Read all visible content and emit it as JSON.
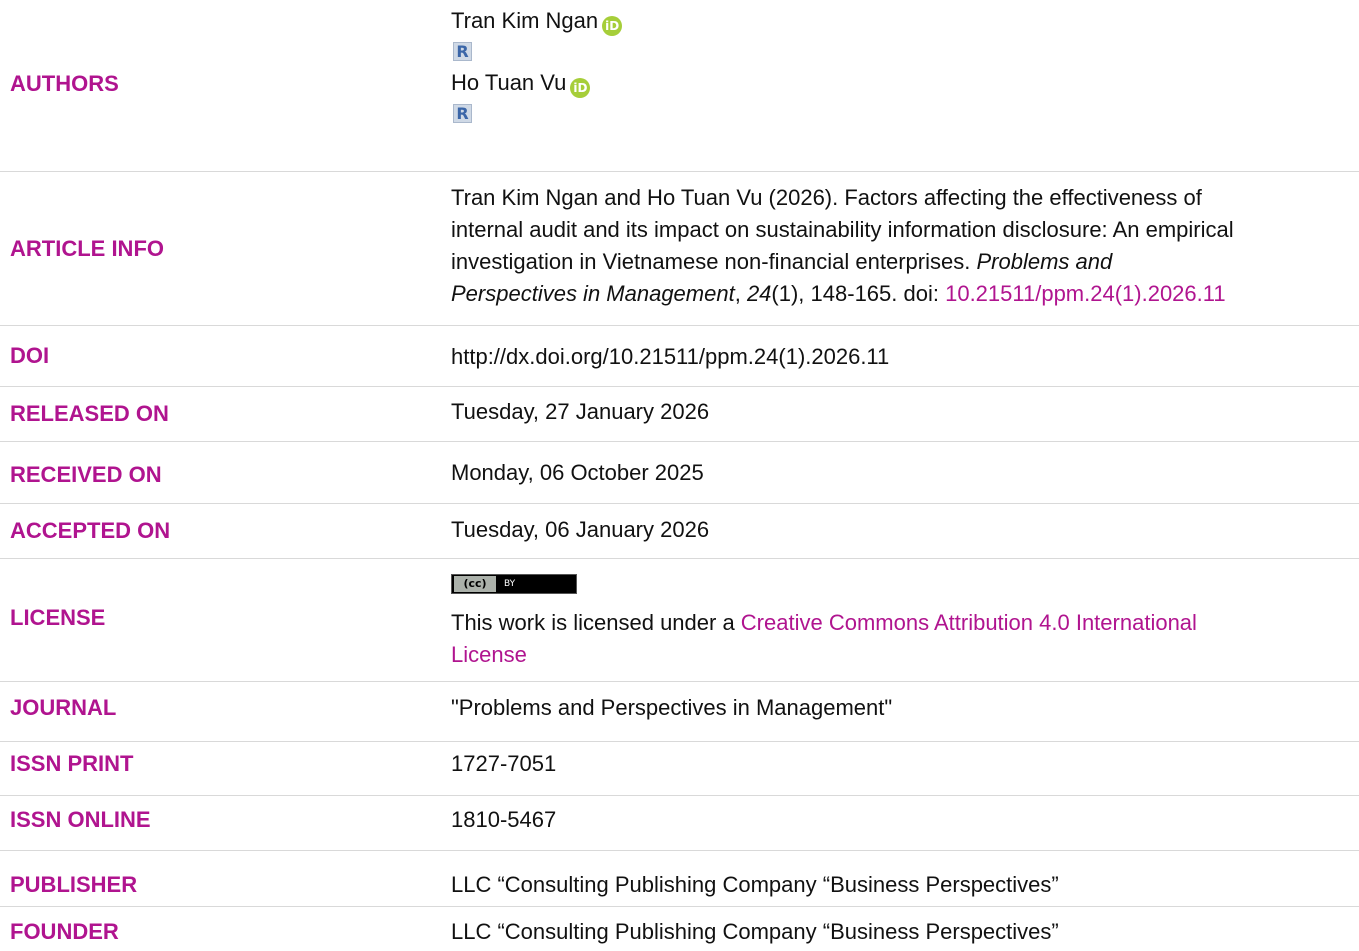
{
  "authors": {
    "label": "AUTHORS",
    "list": [
      {
        "name": "Tran Kim Ngan",
        "orcid_icon": "iD",
        "researchgate_icon": "R"
      },
      {
        "name": "Ho Tuan Vu",
        "orcid_icon": "iD",
        "researchgate_icon": "R"
      }
    ]
  },
  "article_info": {
    "label": "ARTICLE INFO",
    "citation_prefix": "Tran Kim Ngan and Ho Tuan Vu (2026). Factors affecting the effectiveness of internal audit and its impact on sustainability information disclosure: An empirical investigation in Vietnamese non-financial enterprises.",
    "line1": "Tran Kim Ngan and Ho Tuan Vu (2026). Factors affecting the effectiveness of",
    "line2": "internal audit and its impact on sustainability information disclosure: An empirical",
    "line3": "investigation in Vietnamese non-financial enterprises.",
    "journal_italic_a": "Problems and",
    "journal_italic_b": "Perspectives in Management",
    "volume_italic": "24",
    "issue_pages": "(1), 148-165. doi: ",
    "doi_link": "10.21511/ppm.24(1).2026.11"
  },
  "doi": {
    "label": "DOI",
    "value": "http://dx.doi.org/10.21511/ppm.24(1).2026.11"
  },
  "released": {
    "label": "RELEASED ON",
    "value": "Tuesday, 27 January 2026"
  },
  "received": {
    "label": "RECEIVED ON",
    "value": "Monday, 06 October 2025"
  },
  "accepted": {
    "label": "ACCEPTED ON",
    "value": "Tuesday, 06 January 2026"
  },
  "license": {
    "label": "LICENSE",
    "badge_cc": "(cc)",
    "badge_by": "BY",
    "text_prefix": "This work is licensed under a ",
    "link_text_line1": "Creative Commons Attribution 4.0 International",
    "link_text_line2": "License"
  },
  "journal": {
    "label": "JOURNAL",
    "value": "\"Problems and Perspectives in Management\""
  },
  "issn_print": {
    "label": "ISSN PRINT",
    "value": "1727-7051"
  },
  "issn_online": {
    "label": "ISSN ONLINE",
    "value": "1810-5467"
  },
  "publisher": {
    "label": "PUBLISHER",
    "value": "LLC “Consulting Publishing Company “Business Perspectives”"
  },
  "founder": {
    "label": "FOUNDER",
    "value": "LLC “Consulting Publishing Company “Business Perspectives”"
  },
  "colors": {
    "label_color": "#b0148f",
    "link_color": "#b0148f",
    "orcid_green": "#a6ce39",
    "divider": "#d9d9d9"
  }
}
